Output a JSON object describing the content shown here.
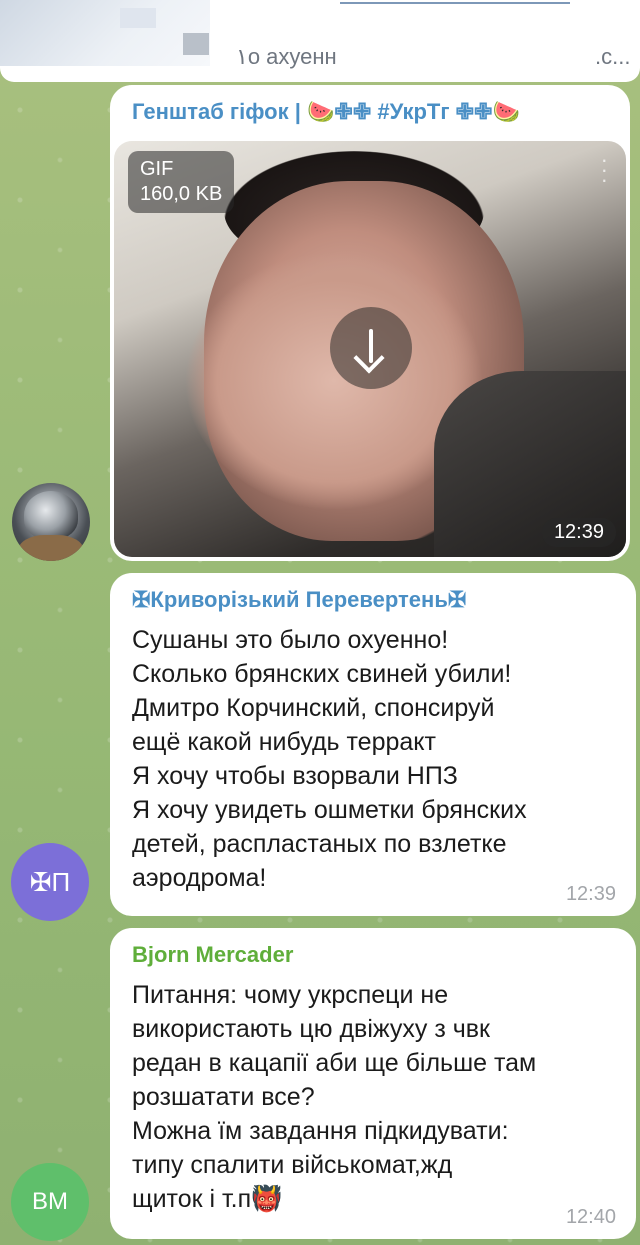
{
  "top": {
    "reply_left": "۱о ахуенн",
    "reply_right": "‌.с..."
  },
  "gif_post": {
    "sender": "Генштаб гіфок | 🍉✙✙ #УкрТг ✙✙🍉",
    "type": "GIF",
    "size": "160,0 KB",
    "time": "12:39",
    "download_icon": "arrow-down-icon"
  },
  "message1": {
    "sender": "✠Криворізький Перевертень✠",
    "lines": [
      "Сушаны это было охуенно!",
      "Сколько брянских свиней убили!",
      "Дмитро Корчинский, спонсируй",
      "ещё какой нибудь терракт",
      "Я хочу чтобы взорвали НПЗ",
      "Я хочу увидеть ошметки брянских",
      "детей, распластаных по взлетке",
      "аэродрома!"
    ],
    "time": "12:39",
    "avatar": "✠П"
  },
  "message2": {
    "sender": "Bjorn Mercader",
    "lines": [
      "Питання: чому укрспеци не",
      "використають цю двіжуху з чвк",
      "редан в кацапії аби ще більше там",
      "розшатати все?",
      "Можна їм завдання підкидувати:",
      "типу спалити військомат,жд",
      "щиток і т.п👹"
    ],
    "time": "12:40",
    "avatar": "BM"
  },
  "colors": {
    "sender_blue": "#4a8fc5",
    "sender_green": "#5fae3a",
    "avatar_purple": "#7c6fd8",
    "avatar_green": "#5fbf6b"
  }
}
